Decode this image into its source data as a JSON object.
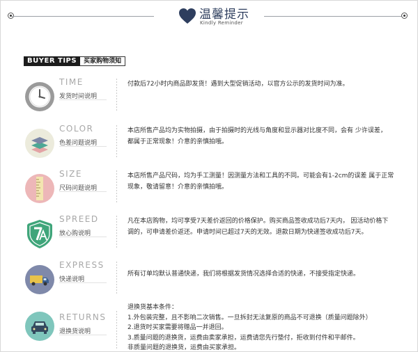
{
  "header": {
    "title": "温馨提示",
    "subtitle": "Kindly Reminder"
  },
  "tips_label": {
    "en": "BUYER TIPS",
    "zh": "买家购物须知"
  },
  "items": [
    {
      "en": "TIME",
      "zh": "发货时间说明",
      "icon": "clock-icon",
      "lines": [
        "付款后72小时内商品即发货！遇到大型促销活动，以官方公示的发货时间为准。"
      ]
    },
    {
      "en": "COLOR",
      "zh": "色差问题说明",
      "icon": "color-layers-icon",
      "lines": [
        "本店所售产品均为实物拍摄，由于拍摄时的光线与角度和显示器对比度不同，会有  少许误差，",
        "都属于正常现象！介意的亲慎拍哦。"
      ]
    },
    {
      "en": "SIZE",
      "zh": "尺码问题说明",
      "icon": "ruler-icon",
      "lines": [
        "本店所售产品尺码，均为手工测量！因测量方法和工具的不同。可能会有1-2cm的误差  属于正常",
        "现象，敬请留意！介意的亲慎拍哦。"
      ]
    },
    {
      "en": "SPREED",
      "zh": "放心购说明",
      "icon": "seven-day-shield-icon",
      "lines": [
        "凡在本店购物，均可享受7天差价返回的价格保护。购买商品签收成功后7天内，  因活动价格下",
        "调的，可申请差价返还。申请时间已超过7天的无效。退款日期为快递签收成功后7天。"
      ]
    },
    {
      "en": "EXPRESS",
      "zh": "快递说明",
      "icon": "truck-icon",
      "lines": [
        "所有订单均默认普通快递，我们将根据发货情况选择合适的快递，不接受指定快递。"
      ]
    },
    {
      "en": "RETURNS",
      "zh": "退换货说明",
      "icon": "car-return-icon",
      "lines": [
        "退换货基本条件：",
        "1.外包装完整，且不影响二次销售。一旦拆封无法复原的商品不可退换（质量问题除外）",
        "2.退货时买家需要将赠品一并退回。",
        "3.质量问题的退换货，运费由卖家承担，运费请您先行垫付，拒收到付件和平邮件。",
        "非质量问题的退换货，运费由买家承担。"
      ]
    }
  ],
  "colors": {
    "navy": "#2e3e5e",
    "clock_ring": "#9a9a9a",
    "color_bg": "#ecebdc",
    "ruler_bg": "#edb7b8",
    "shield_bg": "#3fa57a",
    "express_bg": "#7f89aa",
    "returns_bg": "#7fc6bc"
  }
}
